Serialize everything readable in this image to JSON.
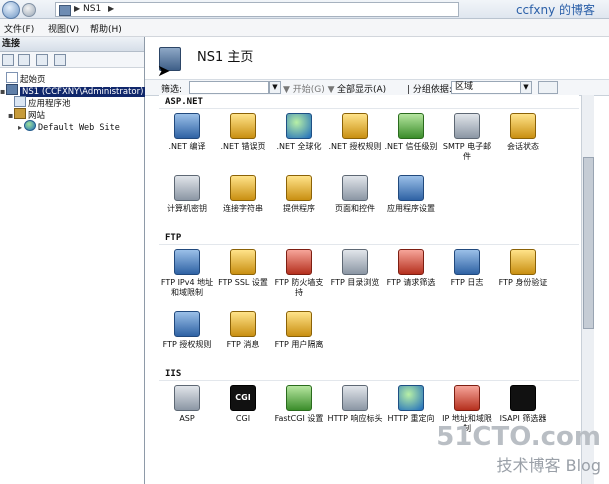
{
  "address_bar": {
    "path": "NS1",
    "sep": "▶",
    "blog_title": "ccfxny 的博客"
  },
  "menu": [
    {
      "label": "文件(F)"
    },
    {
      "label": "视图(V)"
    },
    {
      "label": "帮助(H)"
    }
  ],
  "connections": {
    "header": "连接",
    "tree": [
      {
        "label": "起始页",
        "icon": "start-page-icon"
      },
      {
        "label": "NS1 (CCFXNY\\Administrator)",
        "icon": "server-icon",
        "selected": true
      },
      {
        "label": "应用程序池",
        "icon": "app-pool-icon"
      },
      {
        "label": "网站",
        "icon": "sites-folder-icon"
      },
      {
        "label": "Default Web Site",
        "icon": "globe-icon"
      }
    ]
  },
  "page": {
    "title": "NS1 主页"
  },
  "filter": {
    "label": "筛选:",
    "go_label": "▼ 开始(G) ▼",
    "show_all_label": "全部显示(A)",
    "group_by_label": "| 分组依据:",
    "group_by_value": "区域"
  },
  "groups": [
    {
      "title": "ASP.NET",
      "items": [
        {
          "label": ".NET 编译",
          "icon": "dotnet-compile-icon",
          "color": "blue"
        },
        {
          "label": ".NET 错误页",
          "icon": "dotnet-error-pages-icon",
          "color": "gold"
        },
        {
          "label": ".NET 全球化",
          "icon": "dotnet-globalization-icon",
          "color": "globe"
        },
        {
          "label": ".NET 授权规则",
          "icon": "dotnet-authorization-icon",
          "color": "gold"
        },
        {
          "label": ".NET 信任级别",
          "icon": "dotnet-trust-levels-icon",
          "color": "green"
        },
        {
          "label": "SMTP 电子邮件",
          "icon": "smtp-email-icon",
          "color": "gray"
        },
        {
          "label": "会话状态",
          "icon": "session-state-icon",
          "color": "gold"
        },
        {
          "label": "计算机密钥",
          "icon": "machine-key-icon",
          "color": "gray"
        },
        {
          "label": "连接字符串",
          "icon": "connection-strings-icon",
          "color": "gold"
        },
        {
          "label": "提供程序",
          "icon": "providers-icon",
          "color": "gold"
        },
        {
          "label": "页面和控件",
          "icon": "pages-controls-icon",
          "color": "gray"
        },
        {
          "label": "应用程序设置",
          "icon": "app-settings-icon",
          "color": "blue"
        }
      ]
    },
    {
      "title": "FTP",
      "items": [
        {
          "label": "FTP IPv4 地址和域限制",
          "icon": "ftp-ip-restrictions-icon",
          "color": "blue"
        },
        {
          "label": "FTP SSL 设置",
          "icon": "ftp-ssl-icon",
          "color": "gold"
        },
        {
          "label": "FTP 防火墙支持",
          "icon": "ftp-firewall-icon",
          "color": "red"
        },
        {
          "label": "FTP 目录浏览",
          "icon": "ftp-dir-browsing-icon",
          "color": "gray"
        },
        {
          "label": "FTP 请求筛选",
          "icon": "ftp-request-filtering-icon",
          "color": "red"
        },
        {
          "label": "FTP 日志",
          "icon": "ftp-logging-icon",
          "color": "blue"
        },
        {
          "label": "FTP 身份验证",
          "icon": "ftp-authentication-icon",
          "color": "gold"
        },
        {
          "label": "FTP 授权规则",
          "icon": "ftp-authorization-icon",
          "color": "blue"
        },
        {
          "label": "FTP 消息",
          "icon": "ftp-messages-icon",
          "color": "gold"
        },
        {
          "label": "FTP 用户隔离",
          "icon": "ftp-user-isolation-icon",
          "color": "gold"
        }
      ]
    },
    {
      "title": "IIS",
      "items": [
        {
          "label": "ASP",
          "icon": "asp-icon",
          "color": "gray"
        },
        {
          "label": "CGI",
          "icon": "cgi-icon",
          "color": "black",
          "glyph": "CGI"
        },
        {
          "label": "FastCGI 设置",
          "icon": "fastcgi-icon",
          "color": "green"
        },
        {
          "label": "HTTP 响应标头",
          "icon": "http-response-headers-icon",
          "color": "gray"
        },
        {
          "label": "HTTP 重定向",
          "icon": "http-redirect-icon",
          "color": "globe"
        },
        {
          "label": "IP 地址和域限制",
          "icon": "ip-restrictions-icon",
          "color": "red"
        },
        {
          "label": "ISAPI 筛选器",
          "icon": "isapi-filters-icon",
          "color": "black"
        }
      ]
    }
  ],
  "watermark": {
    "top": "51CTO.com",
    "bottom": "技术博客  Blog"
  }
}
